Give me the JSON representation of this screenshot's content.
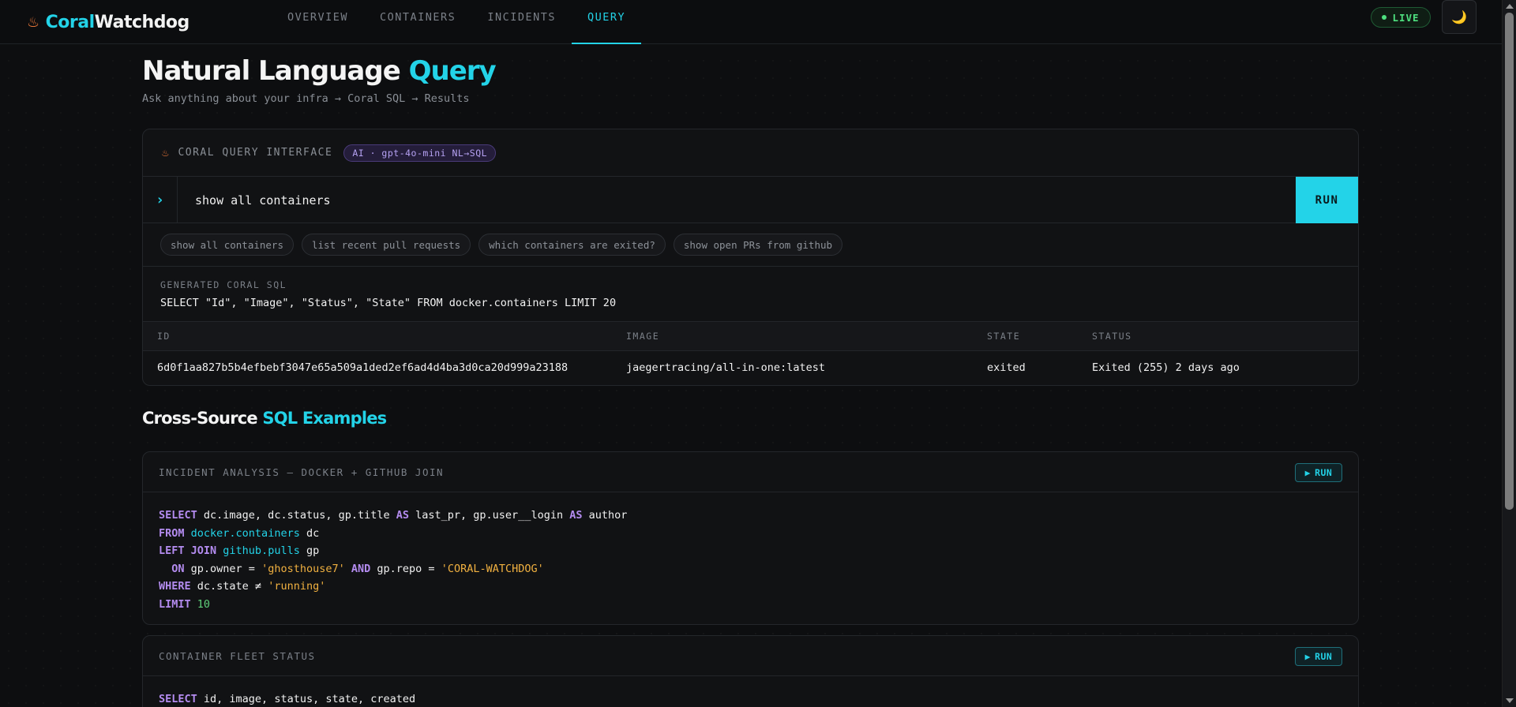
{
  "brand": {
    "logo_icon": "coral-icon",
    "part1": "Coral",
    "part2": "Watchdog"
  },
  "nav": [
    {
      "label": "OVERVIEW",
      "active": false
    },
    {
      "label": "CONTAINERS",
      "active": false
    },
    {
      "label": "INCIDENTS",
      "active": false
    },
    {
      "label": "QUERY",
      "active": true
    }
  ],
  "status": {
    "live_label": "LIVE"
  },
  "theme": {
    "icon": "moon-icon",
    "glyph": "🌙"
  },
  "page": {
    "title_main": "Natural Language ",
    "title_accent": "Query",
    "subtitle": "Ask anything about your infra → Coral SQL → Results"
  },
  "query_interface": {
    "label": "CORAL QUERY INTERFACE",
    "badge": "AI · gpt-4o-mini NL→SQL",
    "input_value": "show all containers",
    "run_label": "RUN",
    "suggestions": [
      "show all containers",
      "list recent pull requests",
      "which containers are exited?",
      "show open PRs from github"
    ],
    "sql_label": "GENERATED CORAL SQL",
    "sql": "SELECT \"Id\", \"Image\", \"Status\", \"State\" FROM docker.containers LIMIT 20"
  },
  "results": {
    "columns": [
      "ID",
      "IMAGE",
      "STATE",
      "STATUS"
    ],
    "rows": [
      [
        "6d0f1aa827b5b4efbebf3047e65a509a1ded2ef6ad4d4ba3d0ca20d999a23188",
        "jaegertracing/all-in-one:latest",
        "exited",
        "Exited (255) 2 days ago"
      ]
    ]
  },
  "examples_section": {
    "title_main": "Cross-Source ",
    "title_accent": "SQL Examples"
  },
  "examples": [
    {
      "title": "INCIDENT ANALYSIS — DOCKER + GITHUB JOIN",
      "run_label": "RUN",
      "lines": [
        [
          [
            "kw",
            "SELECT"
          ],
          [
            "t",
            " dc.image, dc.status, gp.title "
          ],
          [
            "kw",
            "AS"
          ],
          [
            "t",
            " last_pr, gp.user__login "
          ],
          [
            "kw",
            "AS"
          ],
          [
            "t",
            " author"
          ]
        ],
        [
          [
            "kw",
            "FROM"
          ],
          [
            "t",
            " "
          ],
          [
            "tbl",
            "docker.containers"
          ],
          [
            "t",
            " dc"
          ]
        ],
        [
          [
            "kw",
            "LEFT JOIN"
          ],
          [
            "t",
            " "
          ],
          [
            "tbl",
            "github.pulls"
          ],
          [
            "t",
            " gp"
          ]
        ],
        [
          [
            "t",
            "  "
          ],
          [
            "kw",
            "ON"
          ],
          [
            "t",
            " gp.owner = "
          ],
          [
            "str",
            "'ghosthouse7'"
          ],
          [
            "t",
            " "
          ],
          [
            "kw",
            "AND"
          ],
          [
            "t",
            " gp.repo = "
          ],
          [
            "str",
            "'CORAL-WATCHDOG'"
          ]
        ],
        [
          [
            "kw",
            "WHERE"
          ],
          [
            "t",
            " dc.state ≠ "
          ],
          [
            "str",
            "'running'"
          ]
        ],
        [
          [
            "kw",
            "LIMIT"
          ],
          [
            "t",
            " "
          ],
          [
            "num",
            "10"
          ]
        ]
      ]
    },
    {
      "title": "CONTAINER FLEET STATUS",
      "run_label": "RUN",
      "lines": [
        [
          [
            "kw",
            "SELECT"
          ],
          [
            "t",
            " id, image, status, state, created"
          ]
        ]
      ]
    }
  ],
  "colors": {
    "accent": "#23d3e8",
    "live": "#4ee07f",
    "keyword": "#b48cf0",
    "string": "#f0b040",
    "number": "#5fd07a"
  }
}
